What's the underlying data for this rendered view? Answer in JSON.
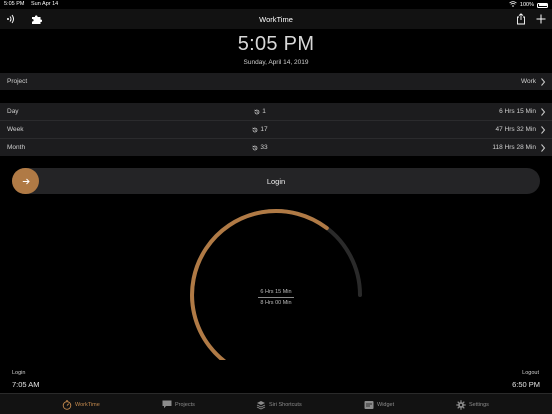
{
  "status_bar": {
    "time": "5:05 PM",
    "date": "Sun Apr 14",
    "battery": "100%"
  },
  "nav": {
    "title": "WorkTime"
  },
  "clock": {
    "time": "5:05 PM",
    "date": "Sunday, April 14, 2019"
  },
  "project_row": {
    "label": "Project",
    "value": "Work"
  },
  "stats": [
    {
      "label": "Day",
      "count": "1",
      "value": "6 Hrs 15 Min"
    },
    {
      "label": "Week",
      "count": "17",
      "value": "47 Hrs 32 Min"
    },
    {
      "label": "Month",
      "count": "33",
      "value": "118 Hrs 28 Min"
    }
  ],
  "login": {
    "label": "Login"
  },
  "gauge": {
    "worked": "6 Hrs 15 Min",
    "target": "8 Hrs 00 Min",
    "progress": 0.78,
    "accent": "#b07a45",
    "track": "#2a2a2a"
  },
  "login_time": {
    "label": "Login",
    "value": "7:05 AM"
  },
  "logout_time": {
    "label": "Logout",
    "value": "6:50 PM"
  },
  "tabs": [
    {
      "label": "WorkTime",
      "icon": "stopwatch-icon",
      "active": true
    },
    {
      "label": "Projects",
      "icon": "chat-icon",
      "active": false
    },
    {
      "label": "Siri Shortcuts",
      "icon": "shortcuts-icon",
      "active": false
    },
    {
      "label": "Widget",
      "icon": "widget-icon",
      "active": false
    },
    {
      "label": "Settings",
      "icon": "gear-icon",
      "active": false
    }
  ],
  "colors": {
    "accent": "#b07a45",
    "tab_active": "#c48a4e",
    "row_bg": "#1c1c1e"
  }
}
